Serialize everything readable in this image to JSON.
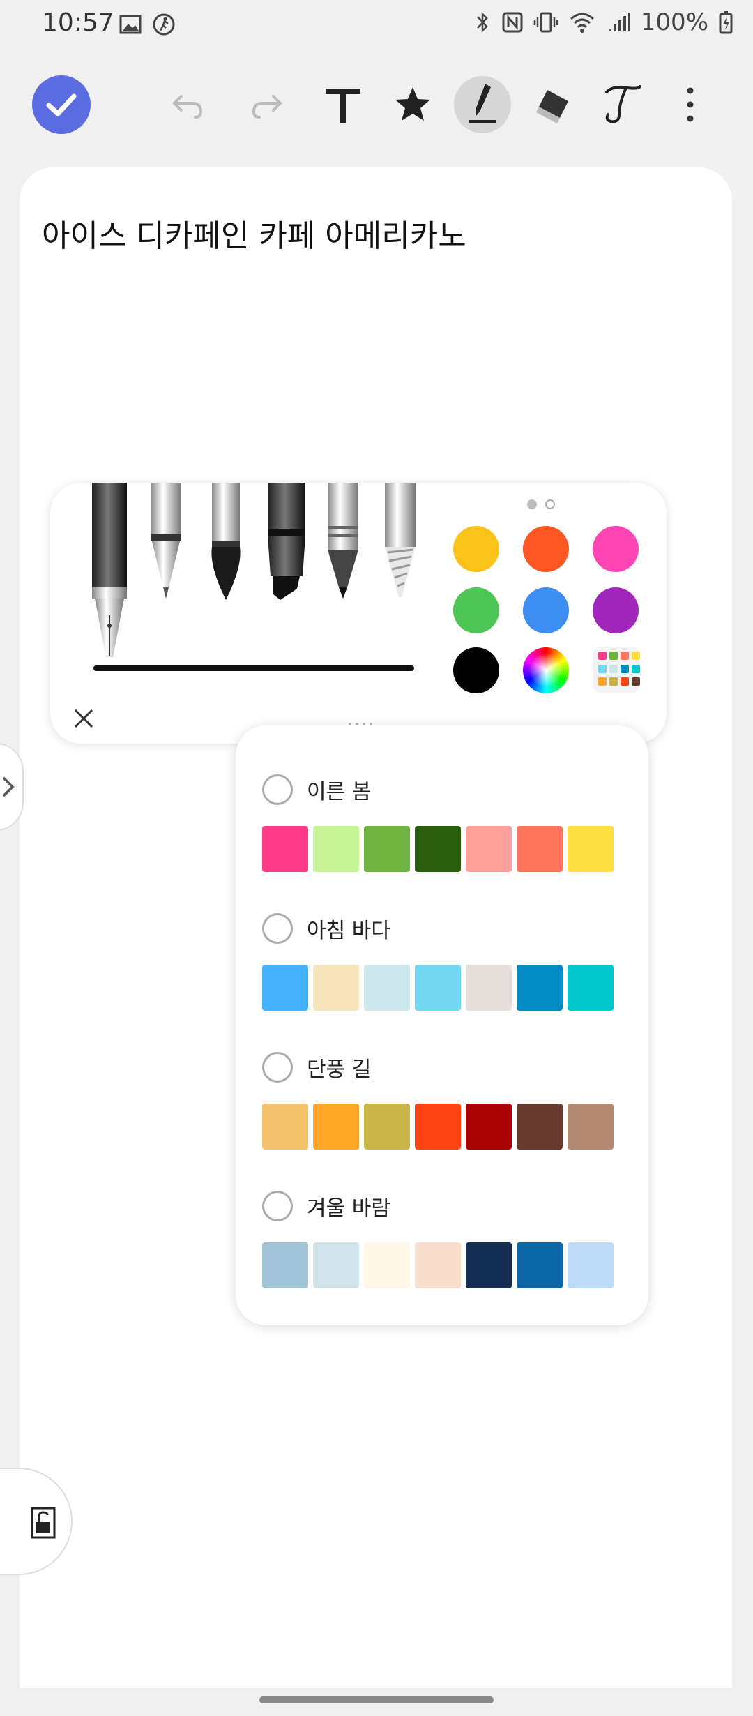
{
  "status_bar": {
    "time": "10:57",
    "battery": "100%",
    "left_icons": [
      "gallery-icon",
      "activity-icon"
    ],
    "right_icons": [
      "bluetooth-icon",
      "nfc-icon",
      "vibrate-icon",
      "wifi-icon",
      "signal-icon",
      "battery-icon"
    ]
  },
  "toolbar": {
    "items": [
      "done-icon",
      "undo-icon",
      "redo-icon",
      "text-icon",
      "favorite-icon",
      "pen-icon",
      "eraser-icon",
      "handwriting-icon",
      "more-icon"
    ],
    "accent": "#5b6be0"
  },
  "note": {
    "title": "아이스 디카페인 카페 아메리카노"
  },
  "pen_panel": {
    "pens": [
      "fountain-pen",
      "ballpoint-pen",
      "brush-pen",
      "marker",
      "pencil",
      "calligraphy-pen"
    ],
    "page_indicator": {
      "count": 2,
      "current": 1
    },
    "colors": [
      "#fbc21a",
      "#ff5622",
      "#ff44b4",
      "#4ec655",
      "#3d8ef0",
      "#a126bb",
      "#000000"
    ],
    "color_picker": "color-wheel-icon",
    "palette_button": "palette-grid-icon"
  },
  "palette_popup": {
    "sets": [
      {
        "label": "이른 봄",
        "colors": [
          "#ff3b88",
          "#c6f396",
          "#6fb440",
          "#2a5c0e",
          "#ffa09d",
          "#ff755e",
          "#fedf41"
        ]
      },
      {
        "label": "아침 바다",
        "colors": [
          "#46b2ff",
          "#f7e4ba",
          "#cbe6ea",
          "#72d7f0",
          "#e5dedb",
          "#028cc3",
          "#03c8cd"
        ]
      },
      {
        "label": "단풍 길",
        "colors": [
          "#f5c36e",
          "#ffa628",
          "#c9b74a",
          "#fe4310",
          "#a90203",
          "#693a2f",
          "#b18872"
        ]
      },
      {
        "label": "겨울 바람",
        "colors": [
          "#a1c3d8",
          "#d0e2ea",
          "#fff8e8",
          "#f9decb",
          "#132d53",
          "#0d66a6",
          "#bddaf7"
        ]
      }
    ]
  }
}
